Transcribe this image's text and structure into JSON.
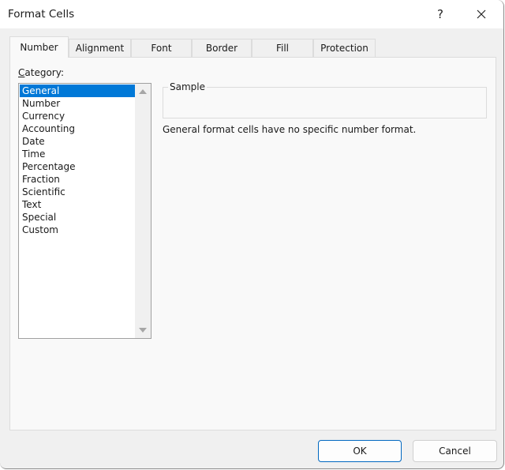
{
  "window": {
    "title": "Format Cells",
    "help_label": "?",
    "close_icon": "close-icon"
  },
  "tabs": [
    {
      "label": "Number",
      "active": true
    },
    {
      "label": "Alignment",
      "active": false
    },
    {
      "label": "Font",
      "active": false
    },
    {
      "label": "Border",
      "active": false
    },
    {
      "label": "Fill",
      "active": false
    },
    {
      "label": "Protection",
      "active": false
    }
  ],
  "number_tab": {
    "category_label_mnemonic": "C",
    "category_label_rest": "ategory:",
    "categories": [
      "General",
      "Number",
      "Currency",
      "Accounting",
      "Date",
      "Time",
      "Percentage",
      "Fraction",
      "Scientific",
      "Text",
      "Special",
      "Custom"
    ],
    "selected_category": "General",
    "sample_label": "Sample",
    "sample_value": "",
    "description": "General format cells have no specific number format."
  },
  "buttons": {
    "ok_label": "OK",
    "cancel_label": "Cancel"
  },
  "colors": {
    "selection": "#0078d7",
    "default_button_border": "#0067c0"
  }
}
